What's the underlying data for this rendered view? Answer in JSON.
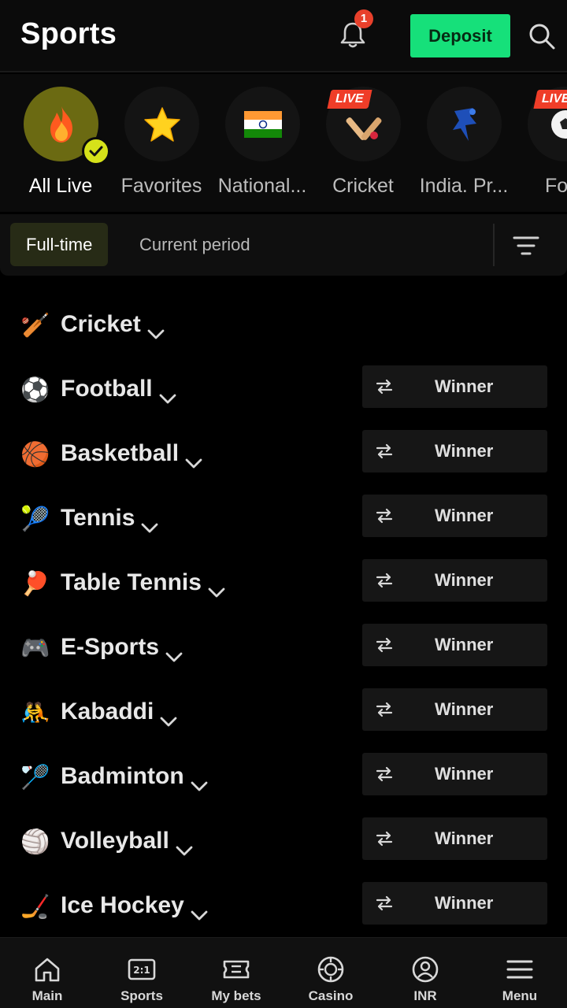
{
  "header": {
    "title": "Sports",
    "notification_count": "1",
    "deposit_label": "Deposit"
  },
  "categories": [
    {
      "label": "All Live",
      "icon": "fire-icon",
      "active": true
    },
    {
      "label": "Favorites",
      "icon": "star-icon"
    },
    {
      "label": "National...",
      "icon": "india-flag-icon"
    },
    {
      "label": "Cricket",
      "icon": "cricket-icon",
      "live": "LIVE"
    },
    {
      "label": "India. Pr...",
      "icon": "ipl-logo-icon"
    },
    {
      "label": "Foot",
      "icon": "football-icon",
      "live": "LIVE"
    }
  ],
  "period": {
    "fulltime": "Full-time",
    "current": "Current period"
  },
  "sports": [
    {
      "name": "Cricket",
      "icon": "cricket-icon",
      "emoji": "🏏"
    },
    {
      "name": "Football",
      "icon": "football-icon",
      "emoji": "⚽",
      "market": "Winner"
    },
    {
      "name": "Basketball",
      "icon": "basketball-icon",
      "emoji": "🏀",
      "market": "Winner"
    },
    {
      "name": "Tennis",
      "icon": "tennis-ball-icon",
      "emoji": "🎾",
      "market": "Winner"
    },
    {
      "name": "Table Tennis",
      "icon": "table-tennis-icon",
      "emoji": "🏓",
      "market": "Winner"
    },
    {
      "name": "E-Sports",
      "icon": "gamepad-icon",
      "emoji": "🎮",
      "market": "Winner"
    },
    {
      "name": "Kabaddi",
      "icon": "kabaddi-icon",
      "emoji": "🤼",
      "market": "Winner"
    },
    {
      "name": "Badminton",
      "icon": "shuttlecock-icon",
      "emoji": "🏸",
      "market": "Winner"
    },
    {
      "name": "Volleyball",
      "icon": "volleyball-icon",
      "emoji": "🏐",
      "market": "Winner"
    },
    {
      "name": "Ice Hockey",
      "icon": "puck-icon",
      "emoji": "🏒",
      "market": "Winner"
    }
  ],
  "bottom_nav": [
    {
      "label": "Main",
      "icon": "home-icon"
    },
    {
      "label": "Sports",
      "icon": "scoreboard-icon"
    },
    {
      "label": "My bets",
      "icon": "ticket-icon"
    },
    {
      "label": "Casino",
      "icon": "casino-chip-icon"
    },
    {
      "label": "INR",
      "icon": "user-icon"
    },
    {
      "label": "Menu",
      "icon": "menu-icon"
    }
  ],
  "colors": {
    "accent_green": "#16e07a",
    "live_red": "#ef3d28",
    "check_yellow": "#d6e21a",
    "background": "#000000"
  }
}
